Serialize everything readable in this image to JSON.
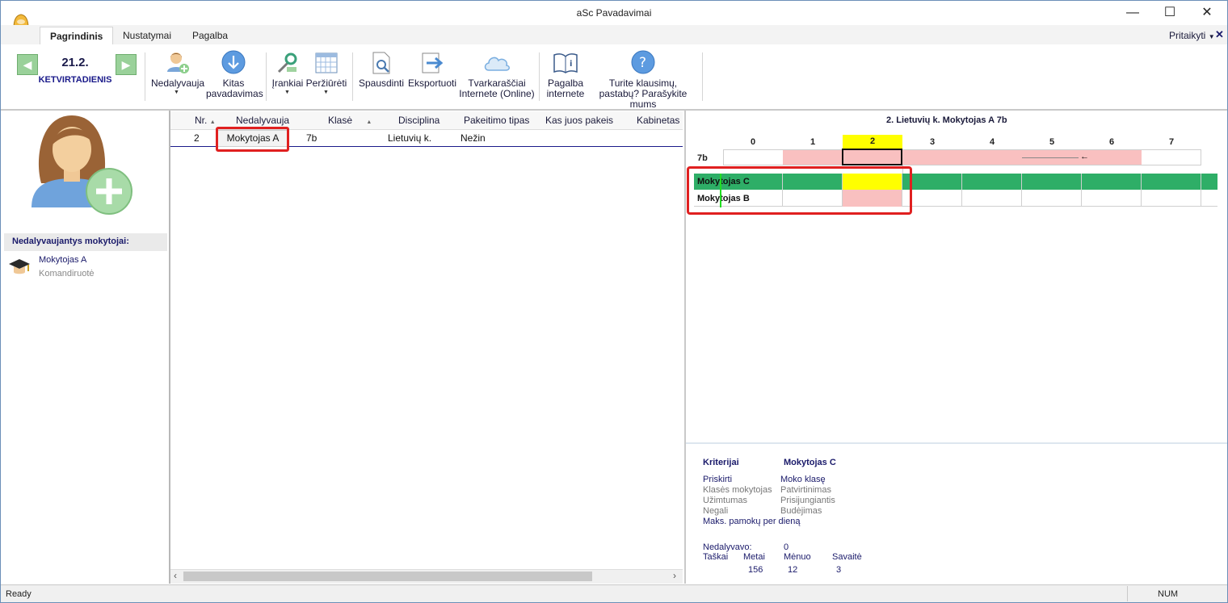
{
  "window": {
    "title": "aSc Pavadavimai"
  },
  "tabs": [
    {
      "label": "Pagrindinis",
      "active": true
    },
    {
      "label": "Nustatymai",
      "active": false
    },
    {
      "label": "Pagalba",
      "active": false
    }
  ],
  "customize": {
    "label": "Pritaikyti"
  },
  "date": {
    "day": "21.2.",
    "weekday": "KETVIRTADIENIS"
  },
  "toolbar": {
    "absent": "Nedalyvauja",
    "other_line1": "Kitas",
    "other_line2": "pavadavimas",
    "tools": "Įrankiai",
    "view": "Peržiūrėti",
    "print": "Spausdinti",
    "export": "Eksportuoti",
    "online_line1": "Tvarkaraščiai",
    "online_line2": "Internete (Online)",
    "help_line1": "Pagalba",
    "help_line2": "internete",
    "question_line1": "Turite klausimų,",
    "question_line2": "pastabų? Parašykite mums"
  },
  "left": {
    "section_title": "Nedalyvaujantys mokytojai:",
    "teacher_name": "Mokytojas A",
    "teacher_status": "Komandiruotė"
  },
  "grid": {
    "columns": [
      "Nr.",
      "Nedalyvauja",
      "Klasė",
      "Disciplina",
      "Pakeitimo tipas",
      "Kas juos pakeis",
      "Kabinetas"
    ],
    "row": {
      "nr": "2",
      "absent": "Mokytojas A",
      "class": "7b",
      "subject": "Lietuvių k.",
      "type": "Nežin"
    }
  },
  "timetable": {
    "title": "2. Lietuvių k. Mokytojas A 7b",
    "periods": [
      "0",
      "1",
      "2",
      "3",
      "4",
      "5",
      "6",
      "7"
    ],
    "class_row": "7b",
    "teacher_rows": [
      "Mokytojas C",
      "Mokytojas B"
    ],
    "arrow": "←",
    "colors": {
      "green": "#2eae67",
      "yellow": "#ffff00",
      "pink": "#f9c0c0",
      "highlight_red": "#e02020"
    }
  },
  "criteria": {
    "title": "Kriterijai",
    "teacher": "Mokytojas C",
    "col1": [
      "Priskirti",
      "Klasės mokytojas",
      "Užimtumas",
      "Negali",
      "Maks. pamokų per dieną"
    ],
    "col2": [
      "Moko klasę",
      "Patvirtinimas",
      "Prisijungiantis",
      "Budėjimas"
    ],
    "absent_label": "Nedalyvavo:",
    "absent_value": "0",
    "points_label": "Taškai",
    "year_label": "Metai",
    "month_label": "Mėnuo",
    "week_label": "Savaitė",
    "year_value": "156",
    "month_value": "12",
    "week_value": "3"
  },
  "status": {
    "left": "Ready",
    "num": "NUM"
  }
}
